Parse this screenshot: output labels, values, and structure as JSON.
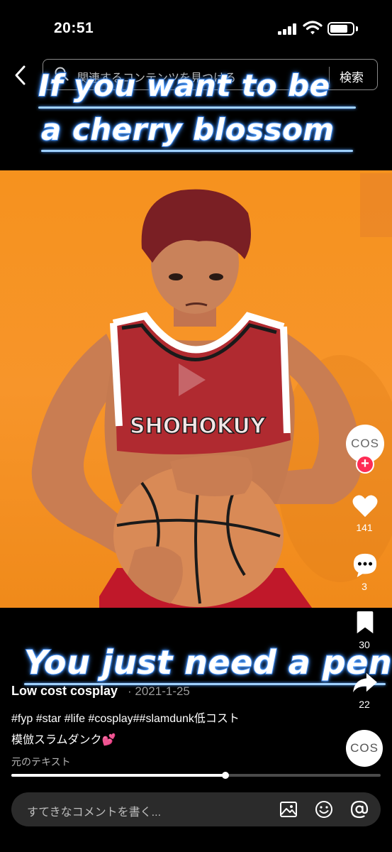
{
  "status_bar": {
    "time": "20:51"
  },
  "search": {
    "placeholder": "関連するコンテンツを見つける",
    "button_label": "検索"
  },
  "captions": {
    "top_line1": "If you want to be",
    "top_line2": "a cherry blossom",
    "bottom": "You just need a pen"
  },
  "video": {
    "jersey_text": "SHOHOKUY"
  },
  "creator": {
    "avatar_text": "COS",
    "follow_symbol": "+"
  },
  "actions": {
    "likes": "141",
    "comments": "3",
    "saves": "30",
    "shares": "22"
  },
  "post": {
    "username": "Low cost cosplay",
    "date": "· 2021-1-25",
    "description_line1": "#fyp #star #life #cosplay##slamdunk低コスト",
    "description_line2": "模倣スラムダンク💕",
    "original_text": "元のテキスト",
    "sound_avatar_text": "COS"
  },
  "playback": {
    "progress_percent": 58
  },
  "comment": {
    "placeholder": "すてきなコメントを書く..."
  },
  "icons": [
    "back-icon",
    "search-icon",
    "heart-icon",
    "comment-icon",
    "bookmark-icon",
    "share-icon",
    "image-icon",
    "emoji-icon",
    "mention-icon",
    "wifi-icon",
    "signal-icon",
    "battery-icon"
  ],
  "colors": {
    "background": "#000000",
    "video_backdrop": "#f6921e",
    "follow_red": "#fe2c55",
    "caption_stroke": "#2a6fd8"
  }
}
